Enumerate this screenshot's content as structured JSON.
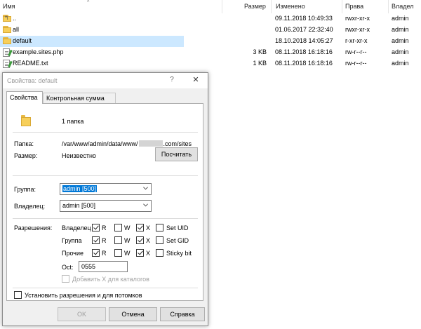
{
  "file_list": {
    "headers": {
      "name": "Имя",
      "size": "Размер",
      "changed": "Изменено",
      "rights": "Права",
      "owner": "Владел"
    },
    "rows": [
      {
        "icon": "parent-folder-icon",
        "name": "..",
        "size": "",
        "changed": "09.11.2018 10:49:33",
        "rights": "rwxr-xr-x",
        "owner": "admin"
      },
      {
        "icon": "folder-icon",
        "name": "all",
        "size": "",
        "changed": "01.06.2017 22:32:40",
        "rights": "rwxr-xr-x",
        "owner": "admin"
      },
      {
        "icon": "folder-icon",
        "name": "default",
        "size": "",
        "changed": "18.10.2018 14:05:27",
        "rights": "r-xr-xr-x",
        "owner": "admin",
        "selected": true
      },
      {
        "icon": "php-file-icon",
        "name": "example.sites.php",
        "size": "3 KB",
        "changed": "08.11.2018 16:18:16",
        "rights": "rw-r--r--",
        "owner": "admin"
      },
      {
        "icon": "text-file-icon",
        "name": "README.txt",
        "size": "1 KB",
        "changed": "08.11.2018 16:18:16",
        "rights": "rw-r--r--",
        "owner": "admin"
      }
    ]
  },
  "dialog": {
    "title": "Свойства: default",
    "help_glyph": "?",
    "close_glyph": "✕",
    "tabs": {
      "properties": "Свойства",
      "checksum": "Контрольная сумма"
    },
    "summary": "1 папка",
    "folder": {
      "label": "Папка:",
      "path_start": "/var/www/admin/data/www/",
      "path_end": ".com/sites"
    },
    "size": {
      "label": "Размер:",
      "value": "Неизвестно",
      "calc_button": "Посчитать"
    },
    "group": {
      "label": "Группа:",
      "value": "admin [500]"
    },
    "owner": {
      "label": "Владелец:",
      "value": "admin [500]"
    },
    "permissions": {
      "label": "Разрешения:",
      "row_owner": "Владелец",
      "row_group": "Группа",
      "row_others": "Прочие",
      "r": "R",
      "w": "W",
      "x": "X",
      "set_uid": "Set UID",
      "set_gid": "Set GID",
      "sticky_bit": "Sticky bit",
      "octal_label": "Oct:",
      "octal_value": "0555",
      "add_x_dirs": "Добавить X для каталогов",
      "checked": {
        "owner": {
          "r": true,
          "w": false,
          "x": true,
          "special": false
        },
        "group": {
          "r": true,
          "w": false,
          "x": true,
          "special": false
        },
        "others": {
          "r": true,
          "w": false,
          "x": true,
          "special": false
        }
      }
    },
    "recursive": "Установить разрешения и для потомков",
    "buttons": {
      "ok": "OK",
      "cancel": "Отмена",
      "help": "Справка"
    }
  }
}
